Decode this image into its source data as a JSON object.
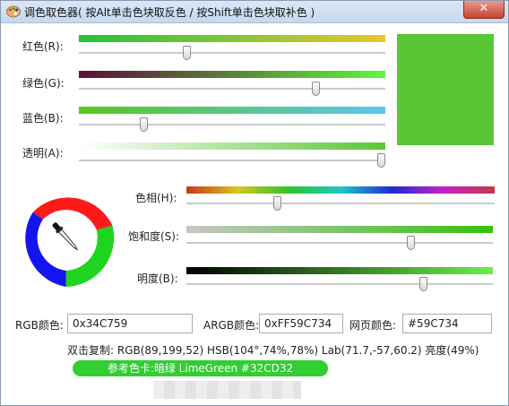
{
  "window": {
    "title": "调色取色器( 按Alt单击色块取反色 / 按Shift单击色块取补色 )",
    "close_glyph": "✕"
  },
  "sliders": [
    {
      "label": "红色(R):",
      "value": 89,
      "max": 255,
      "color_from": "#22c33a",
      "color_to": "#e9c631"
    },
    {
      "label": "绿色(G):",
      "value": 199,
      "max": 255,
      "color_from": "#5a0e3a",
      "color_to": "#5cf83a"
    },
    {
      "label": "蓝色(B):",
      "value": 52,
      "max": 255,
      "color_from": "#57c71c",
      "color_to": "#59c7f1"
    },
    {
      "label": "透明(A):",
      "value": 255,
      "max": 255,
      "color_from": "#ffffff",
      "color_to": "#59c734"
    }
  ],
  "hsb_sliders": [
    {
      "label": "色相(H):",
      "value": 104,
      "max": 360
    },
    {
      "label": "饱和度(S):",
      "value": 74,
      "max": 100
    },
    {
      "label": "明度(B):",
      "value": 78,
      "max": 100
    }
  ],
  "fields": {
    "rgb_label": "RGB颜色:",
    "rgb_value": "0x34C759",
    "argb_label": "ARGB颜色:",
    "argb_value": "0xFF59C734",
    "web_label": "网页颜色:",
    "web_value": "#59C734"
  },
  "info_line": "双击复制: RGB(89,199,52) HSB(104°,74%,78%) Lab(71.7,-57,60.2) 亮度(49%)",
  "reference_card": "参考色卡:暗绿 LimeGreen  #32CD32",
  "colors": {
    "current": "#59c734",
    "reference": "#32cd32",
    "wheel_red": "#ff1a1a",
    "wheel_green": "#1ed41e",
    "wheel_blue": "#1414f0"
  },
  "icons": {
    "app": "palette-icon",
    "picker": "eyedropper-icon"
  }
}
